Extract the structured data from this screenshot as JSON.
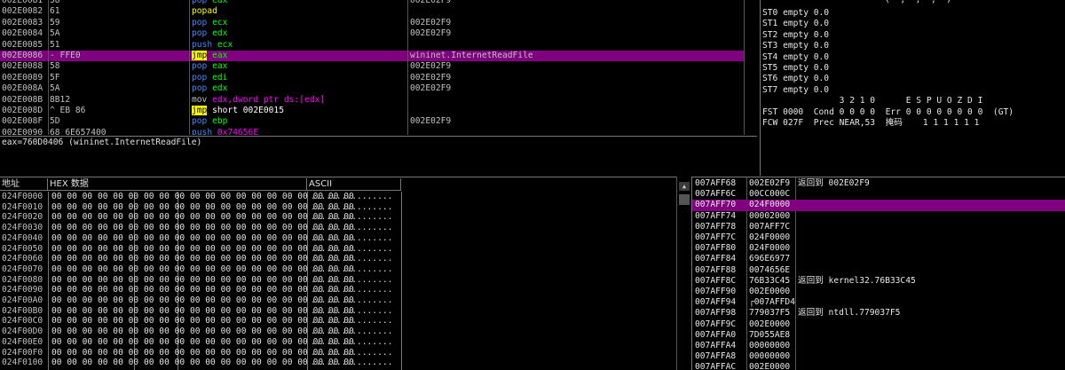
{
  "disasm": {
    "rows": [
      {
        "addr": "002E0081",
        "hex": "58",
        "mn": "pop",
        "ops": "edx",
        "cmt": "002E02F9"
      },
      {
        "addr": "002E0082",
        "hex": "61",
        "mn": "popad",
        "ops": "",
        "cmt": ""
      },
      {
        "addr": "002E0083",
        "hex": "59",
        "mn": "pop",
        "ops": "ecx",
        "cmt": "002E02F9"
      },
      {
        "addr": "002E0084",
        "hex": "5A",
        "mn": "pop",
        "ops": "edx",
        "cmt": "002E02F9"
      },
      {
        "addr": "002E0085",
        "hex": "51",
        "mn": "push",
        "ops": "ecx",
        "cmt": ""
      },
      {
        "addr": "002E0086",
        "hex": "- FFE0",
        "mn": "jmp",
        "ops": "eax",
        "cmt": "wininet.InternetReadFile"
      },
      {
        "addr": "002E0088",
        "hex": "58",
        "mn": "pop",
        "ops": "eax",
        "cmt": "002E02F9"
      },
      {
        "addr": "002E0089",
        "hex": "5F",
        "mn": "pop",
        "ops": "edi",
        "cmt": "002E02F9"
      },
      {
        "addr": "002E008A",
        "hex": "5A",
        "mn": "pop",
        "ops": "edx",
        "cmt": "002E02F9"
      },
      {
        "addr": "002E008B",
        "hex": "8B12",
        "mn": "mov",
        "ops": "edx,dword ptr ds:[edx]",
        "cmt": ""
      },
      {
        "addr": "002E008D",
        "hex": "^ EB 86",
        "mn": "jmp",
        "ops": "short 002E0015",
        "cmt": ""
      },
      {
        "addr": "002E008F",
        "hex": "5D",
        "mn": "pop",
        "ops": "ebp",
        "cmt": "002E02F9"
      },
      {
        "addr": "002E0090",
        "hex": "68 6E657400",
        "mn": "push",
        "ops": "0x74656E",
        "cmt": ""
      }
    ]
  },
  "info": {
    "line1": "eax=760D0406 (wininet.InternetReadFile)"
  },
  "fpu": {
    "lines": [
      "ST0 empty 0.0",
      "ST1 empty 0.0",
      "ST2 empty 0.0",
      "ST3 empty 0.0",
      "ST4 empty 0.0",
      "ST5 empty 0.0",
      "ST6 empty 0.0",
      "ST7 empty 0.0",
      "               3 2 1 0      E S P U O Z D I",
      "FST 0000  Cond 0 0 0 0  Err 0 0 0 0 0 0 0 0  (GT)",
      "FCW 027F  Prec NEAR,53  掩码    1 1 1 1 1 1"
    ],
    "top_fragment": "(  ,  ,  ,  )"
  },
  "dump": {
    "headers": {
      "addr": "地址",
      "hex": "HEX 数据",
      "ascii": "ASCII"
    },
    "hex_line": "00 00 00 00 00 00 00 00 00 00 00 00 00 00 00 00 00 00 00 00",
    "ascii_line": "................",
    "addresses": [
      "024F0000",
      "024F0010",
      "024F0020",
      "024F0030",
      "024F0040",
      "024F0050",
      "024F0060",
      "024F0070",
      "024F0080",
      "024F0090",
      "024F00A0",
      "024F00B0",
      "024F00C0",
      "024F00D0",
      "024F00E0",
      "024F00F0",
      "024F0100"
    ]
  },
  "stack": {
    "rows": [
      {
        "addr": "007AFF68",
        "val": "002E02F9",
        "cmt": "返回到 002E02F9",
        "sel": false
      },
      {
        "addr": "007AFF6C",
        "val": "00CC000C",
        "cmt": "",
        "sel": false
      },
      {
        "addr": "007AFF70",
        "val": "024F0000",
        "cmt": "",
        "sel": true
      },
      {
        "addr": "007AFF74",
        "val": "00002000",
        "cmt": "",
        "sel": false
      },
      {
        "addr": "007AFF78",
        "val": "007AFF7C",
        "cmt": "",
        "sel": false
      },
      {
        "addr": "007AFF7C",
        "val": "024F0000",
        "cmt": "",
        "sel": false
      },
      {
        "addr": "007AFF80",
        "val": "024F0000",
        "cmt": "",
        "sel": false
      },
      {
        "addr": "007AFF84",
        "val": "696E6977",
        "cmt": "",
        "sel": false
      },
      {
        "addr": "007AFF88",
        "val": "0074656E",
        "cmt": "",
        "sel": false
      },
      {
        "addr": "007AFF8C",
        "val": "76B33C45",
        "cmt": "返回到 kernel32.76B33C45",
        "sel": false
      },
      {
        "addr": "007AFF90",
        "val": "002E0000",
        "cmt": "",
        "sel": false
      },
      {
        "addr": "007AFF94",
        "val": "┌007AFFD4",
        "cmt": "",
        "sel": false
      },
      {
        "addr": "007AFF98",
        "val": "779037F5",
        "cmt": "返回到 ntdll.779037F5",
        "sel": false
      },
      {
        "addr": "007AFF9C",
        "val": "002E0000",
        "cmt": "",
        "sel": false
      },
      {
        "addr": "007AFFA0",
        "val": "7D055AE8",
        "cmt": "",
        "sel": false
      },
      {
        "addr": "007AFFA4",
        "val": "00000000",
        "cmt": "",
        "sel": false
      },
      {
        "addr": "007AFFA8",
        "val": "00000000",
        "cmt": "",
        "sel": false
      },
      {
        "addr": "007AFFAC",
        "val": "002E0000",
        "cmt": "",
        "sel": false
      }
    ]
  },
  "colors": {
    "selection": "#800080",
    "jmp_highlight": "#ffff00",
    "register": "#00ff00",
    "push_pop": "#3c8cff",
    "memory": "#ff00ff"
  }
}
